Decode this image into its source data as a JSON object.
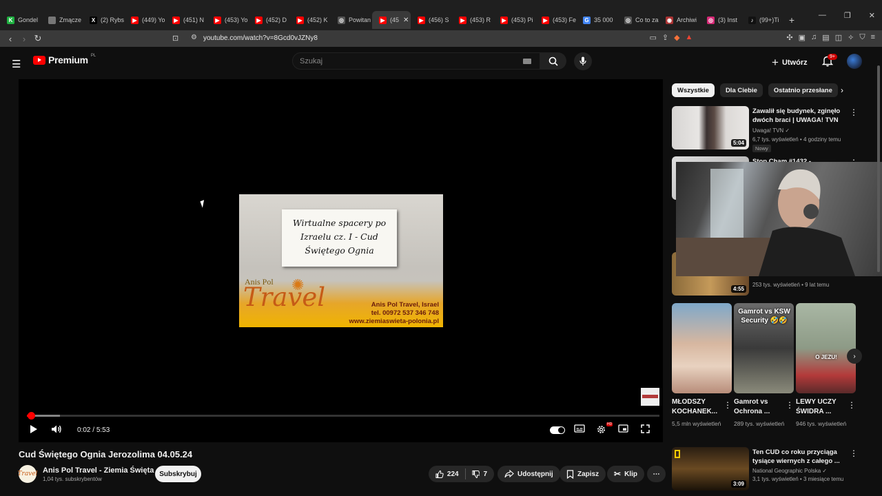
{
  "browser": {
    "tabs": [
      {
        "label": "Gondel",
        "fav": "K",
        "color": "#1fb141"
      },
      {
        "label": "Zmącze",
        "fav": "",
        "color": "#777777"
      },
      {
        "label": "(2) Rybs",
        "fav": "X",
        "color": "#000000"
      },
      {
        "label": "(449) Yo",
        "fav": "▶",
        "color": "#ff0000"
      },
      {
        "label": "(451) N",
        "fav": "▶",
        "color": "#ff0000"
      },
      {
        "label": "(453) Yo",
        "fav": "▶",
        "color": "#ff0000"
      },
      {
        "label": "(452) D",
        "fav": "▶",
        "color": "#ff0000"
      },
      {
        "label": "(452) K",
        "fav": "▶",
        "color": "#ff0000"
      },
      {
        "label": "Powitan",
        "fav": "◎",
        "color": "#555555"
      },
      {
        "label": "(45",
        "fav": "▶",
        "color": "#ff0000",
        "active": true
      },
      {
        "label": "(456) S",
        "fav": "▶",
        "color": "#ff0000"
      },
      {
        "label": "(453) R",
        "fav": "▶",
        "color": "#ff0000"
      },
      {
        "label": "(453) Pi",
        "fav": "▶",
        "color": "#ff0000"
      },
      {
        "label": "(453) Fe",
        "fav": "▶",
        "color": "#ff0000"
      },
      {
        "label": "35 000",
        "fav": "G",
        "color": "#4285f4"
      },
      {
        "label": "Co to za",
        "fav": "◎",
        "color": "#555555"
      },
      {
        "label": "Archiwi",
        "fav": "◉",
        "color": "#a33"
      },
      {
        "label": "(3) Inst",
        "fav": "◎",
        "color": "#d62976"
      },
      {
        "label": "(99+)Ti",
        "fav": "♪",
        "color": "#111111"
      }
    ],
    "close_glyph": "✕",
    "new_tab_glyph": "+",
    "url": "youtube.com/watch?v=8Gcd0vJZNy8"
  },
  "header": {
    "logo_text": "Premium",
    "logo_region": "PL",
    "search_placeholder": "Szukaj",
    "create_label": "Utwórz",
    "notifications_badge": "9+"
  },
  "player": {
    "frame": {
      "card_line1": "Wirtualne spacery po",
      "card_line2": "Izraelu cz. I - Cud",
      "card_line3": "Świętego Ognia",
      "brand_small": "Anis Pol",
      "brand_big": "Travel",
      "contact1": "Anis Pol Travel, Israel",
      "contact2": "tel. 00972 537 346 748",
      "contact3": "www.ziemiaswieta-polonia.pl"
    },
    "time_current": "0:02",
    "time_total": "5:53",
    "progress_fraction": 0.006,
    "buffer_fraction": 0.052,
    "hd_badge": "HD"
  },
  "video": {
    "title": "Cud Świętego Ognia Jerozolima 04.05.24",
    "channel_name": "Anis Pol Travel - Ziemia Święta",
    "channel_avatar_text": "Travel",
    "subscribers": "1,04 tys. subskrybentów",
    "subscribe_label": "Subskrybuj",
    "likes": "224",
    "dislikes": "7",
    "share_label": "Udostępnij",
    "save_label": "Zapisz",
    "clip_label": "Klip",
    "more_label": "⋯"
  },
  "sidebar": {
    "chips": [
      "Wszystkie",
      "Dla Ciebie",
      "Ostatnio przesłane"
    ],
    "videos": [
      {
        "title": "Zawalił się budynek, zginęło dwóch braci | UWAGA! TVN",
        "channel": "Uwaga! TVN ✓",
        "meta": "6,7 tys. wyświetleń • 4 godziny temu",
        "badge": "Nowy",
        "duration": "5:04"
      },
      {
        "title": "Stop Cham #1432 -",
        "channel": "",
        "meta": "",
        "duration": ""
      },
      {
        "title": "",
        "channel": "",
        "meta": "253 tys. wyświetleń • 9 lat temu",
        "duration": "4:55"
      }
    ],
    "shorts": [
      {
        "title": "MŁODSZY KOCHANEK...",
        "views": "5,5 mln wyświetleń",
        "overlay": ""
      },
      {
        "title": "Gamrot vs Ochrona ...",
        "views": "289 tys. wyświetleń",
        "overlay": "Gamrot vs KSW Security 🤣🤣"
      },
      {
        "title": "LEWY UCZY ŚWIDRA ...",
        "views": "946 tys. wyświetleń",
        "overlay": "O JEZU!"
      }
    ],
    "bottom_video": {
      "title": "Ten CUD co roku przyciąga tysiące wiernych z całego ...",
      "channel": "National Geographic Polska ✓",
      "meta": "3,1 tys. wyświetleń • 3 miesiące temu",
      "duration": "3:09"
    }
  }
}
